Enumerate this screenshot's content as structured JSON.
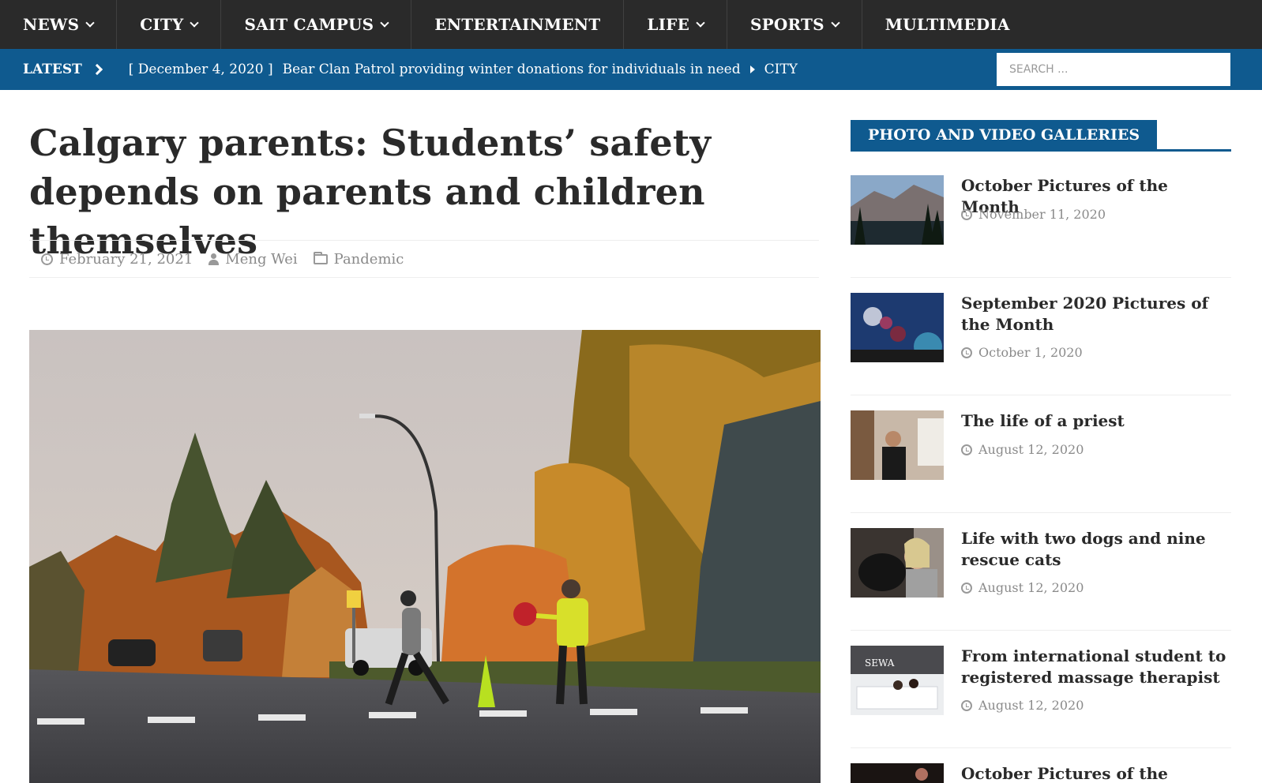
{
  "nav": {
    "items": [
      {
        "label": "NEWS",
        "dropdown": true
      },
      {
        "label": "CITY",
        "dropdown": true
      },
      {
        "label": "SAIT CAMPUS",
        "dropdown": true
      },
      {
        "label": "ENTERTAINMENT",
        "dropdown": false
      },
      {
        "label": "LIFE",
        "dropdown": true
      },
      {
        "label": "SPORTS",
        "dropdown": true
      },
      {
        "label": "MULTIMEDIA",
        "dropdown": false
      }
    ]
  },
  "latest": {
    "label": "LATEST",
    "date": "[ December 4, 2020 ]",
    "headline": "Bear Clan Patrol providing winter donations for individuals in need",
    "category": "CITY"
  },
  "search": {
    "placeholder": "SEARCH ..."
  },
  "article": {
    "title": "Calgary parents: Students’ safety depends on parents and children themselves",
    "date": "February 21, 2021",
    "author": "Meng Wei",
    "category": "Pandemic"
  },
  "sidebar": {
    "title": "PHOTO AND VIDEO GALLERIES",
    "items": [
      {
        "title": "October Pictures of the Month",
        "date": "November 11, 2020"
      },
      {
        "title": "September 2020 Pictures of the Month",
        "date": "October 1, 2020"
      },
      {
        "title": "The life of a priest",
        "date": "August 12, 2020"
      },
      {
        "title": "Life with two dogs and nine rescue cats",
        "date": "August 12, 2020"
      },
      {
        "title": "From international student to registered massage therapist",
        "date": "August 12, 2020"
      },
      {
        "title": "October Pictures of the Month",
        "date": ""
      }
    ]
  },
  "colors": {
    "nav_bg": "#2a2a2a",
    "accent": "#0f5a8f"
  }
}
